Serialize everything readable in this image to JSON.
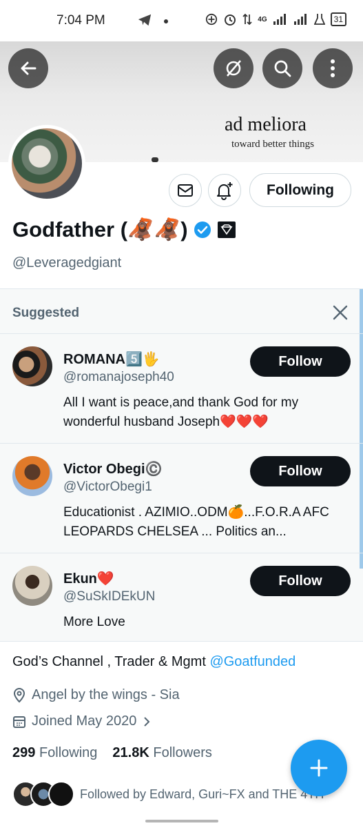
{
  "status_bar": {
    "time": "7:04 PM",
    "network": "4G",
    "battery": "31",
    "icons": [
      "telegram-icon",
      "dot-icon",
      "add-circle-icon",
      "alarm-icon",
      "data-arrows-icon",
      "signal-icon",
      "signal-icon",
      "flask-icon",
      "battery-icon"
    ]
  },
  "banner": {
    "motto": "ad meliora",
    "motto_sub": "toward better things"
  },
  "nav_buttons": {
    "back": "back-arrow-icon",
    "grok": "grok-icon",
    "search": "search-icon",
    "more": "more-vertical-icon"
  },
  "profile": {
    "name": "Godfather (🦧🦧)",
    "handle": "@Leveragedgiant",
    "following_button": "Following",
    "bio_text": "God’s Channel , Trader & Mgmt ",
    "bio_link": "@Goatfunded",
    "location": "Angel by the wings - Sia",
    "joined": "Joined May 2020",
    "following_count": "299",
    "following_label": "Following",
    "followers_count": "21.8K",
    "followers_label": "Followers",
    "followed_by": "Followed by Edward, Guri~FX and THE 4TH"
  },
  "suggested": {
    "title": "Suggested",
    "follow_label": "Follow",
    "users": [
      {
        "name": "ROMANA5️⃣🖐",
        "handle": "@romanajoseph40",
        "bio": "All I want is peace,and thank God for my wonderful husband Joseph❤️❤️❤️"
      },
      {
        "name": "Victor Obegi©️",
        "handle": "@VictorObegi1",
        "bio": "Educationist . AZIMIO..ODM🍊...F.O.R.A AFC LEOPARDS CHELSEA ... Politics an..."
      },
      {
        "name": "Ekun❤️",
        "handle": "@SuSkIDEkUN",
        "bio": "More Love"
      }
    ]
  },
  "colors": {
    "accent": "#1d9bf0",
    "text_primary": "#0f1419",
    "text_secondary": "#536471",
    "follow_button": "#0f1419"
  }
}
